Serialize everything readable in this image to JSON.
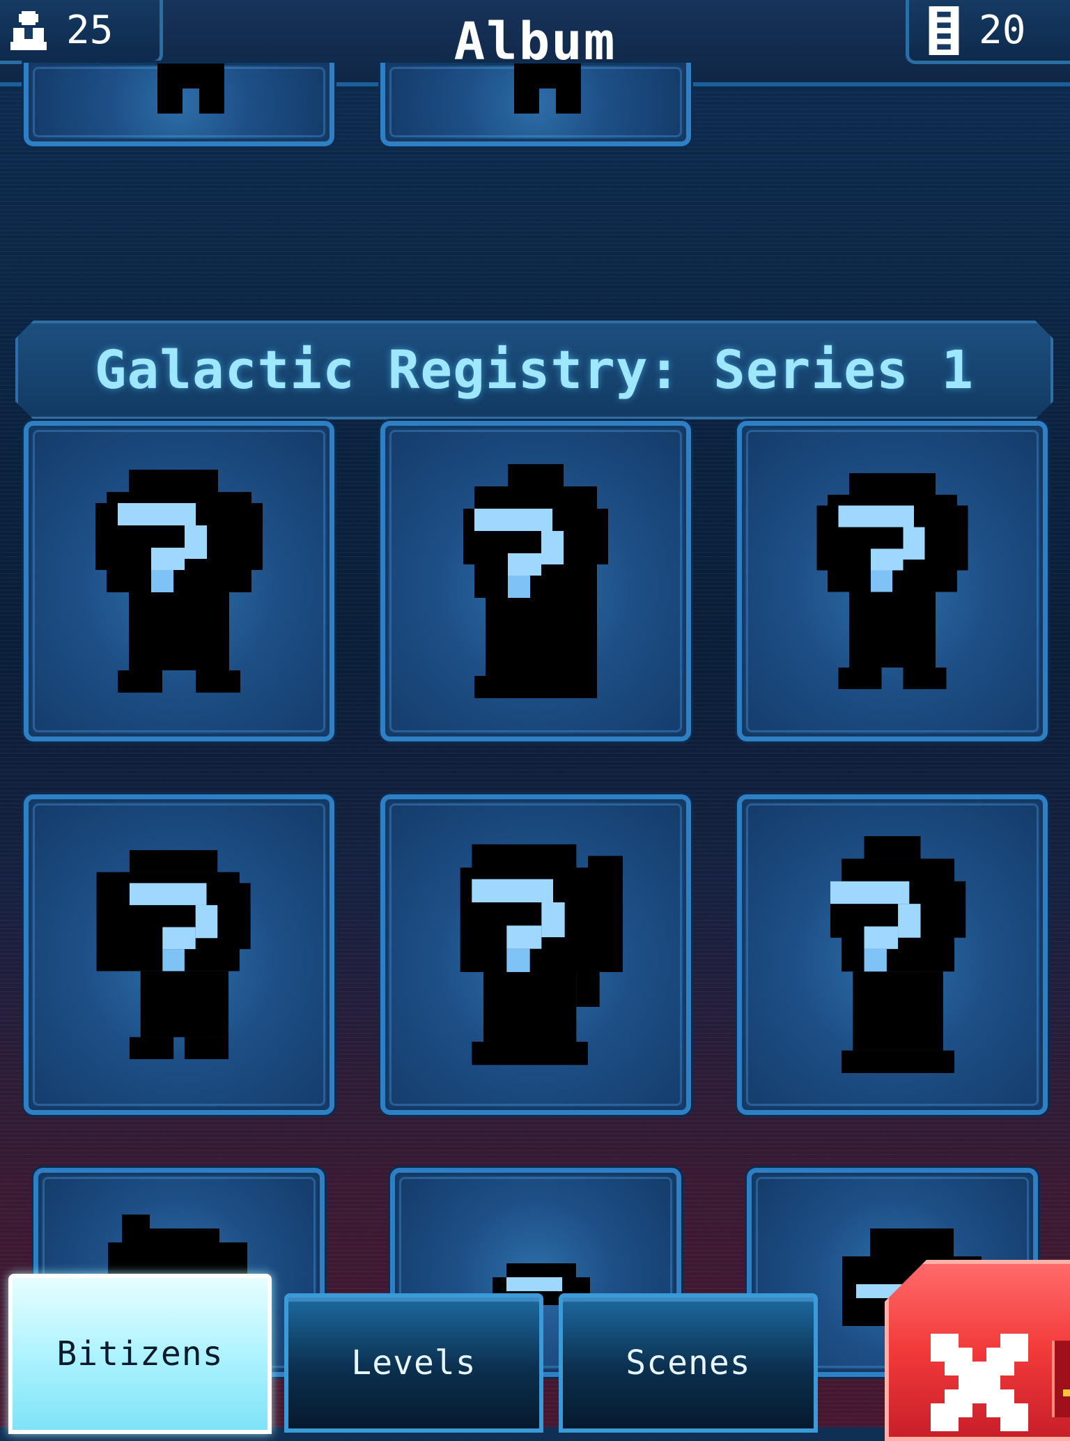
{
  "header": {
    "title": "Album",
    "population_count": "25",
    "floors_count": "20",
    "population_icon": "bitizen-person-icon",
    "floors_icon": "tower-floors-icon"
  },
  "series_banner": "Galactic Registry: Series 1",
  "cards": {
    "unknown_marker": "?",
    "unknown_label": "unknown-bitizen"
  },
  "tabs": [
    {
      "label": "Bitizens",
      "active": true
    },
    {
      "label": "Levels",
      "active": false
    },
    {
      "label": "Scenes",
      "active": false
    }
  ],
  "close_button": {
    "icon": "close-x-icon"
  },
  "colors": {
    "accent_blue": "#2f7fc4",
    "banner_text": "#9fe6ff",
    "active_tab": "#aef3ff",
    "close_red": "#f23a3a"
  }
}
